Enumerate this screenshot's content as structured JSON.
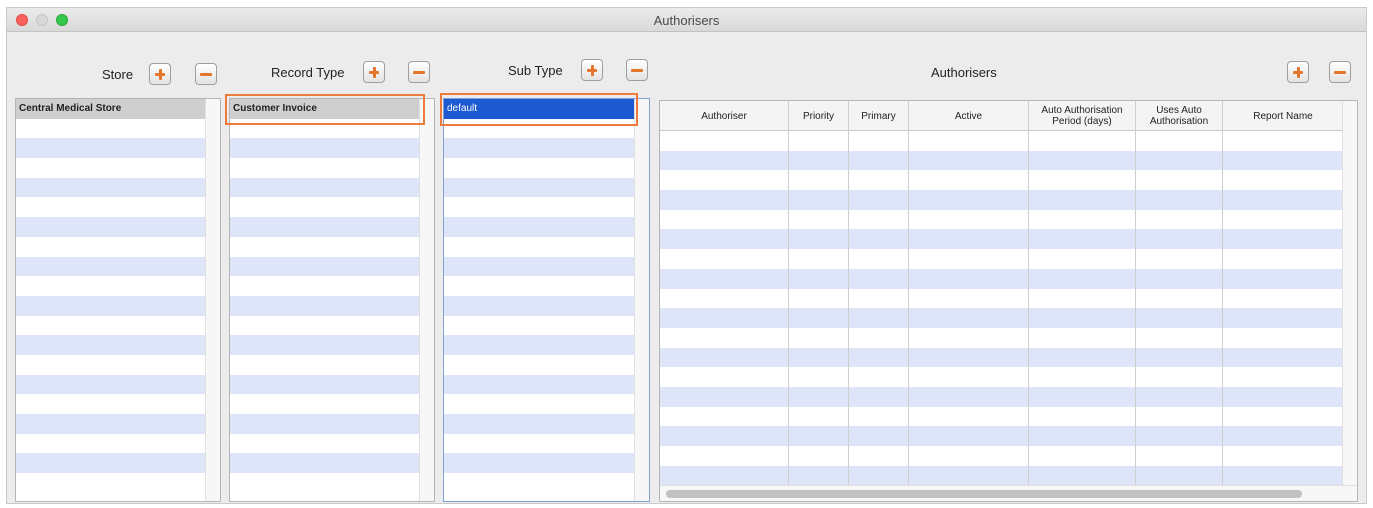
{
  "window": {
    "title": "Authorisers"
  },
  "store": {
    "label": "Store",
    "items": [
      "Central Medical Store"
    ]
  },
  "record_type": {
    "label": "Record Type",
    "items": [
      "Customer Invoice"
    ]
  },
  "sub_type": {
    "label": "Sub Type",
    "items": [
      "default"
    ]
  },
  "authorisers": {
    "label": "Authorisers",
    "columns": [
      {
        "line1": "Authoriser",
        "line2": ""
      },
      {
        "line1": "Priority",
        "line2": ""
      },
      {
        "line1": "Primary",
        "line2": ""
      },
      {
        "line1": "Active",
        "line2": ""
      },
      {
        "line1": "Auto Authorisation",
        "line2": "Period  (days)"
      },
      {
        "line1": "Uses Auto",
        "line2": "Authorisation"
      },
      {
        "line1": "Report Name",
        "line2": ""
      }
    ]
  },
  "icons": {
    "add": "plus-icon",
    "remove": "minus-icon",
    "accent_color": "#e3762b",
    "selection_color": "#1d59d1",
    "highlight_color": "#ec7b3c"
  }
}
